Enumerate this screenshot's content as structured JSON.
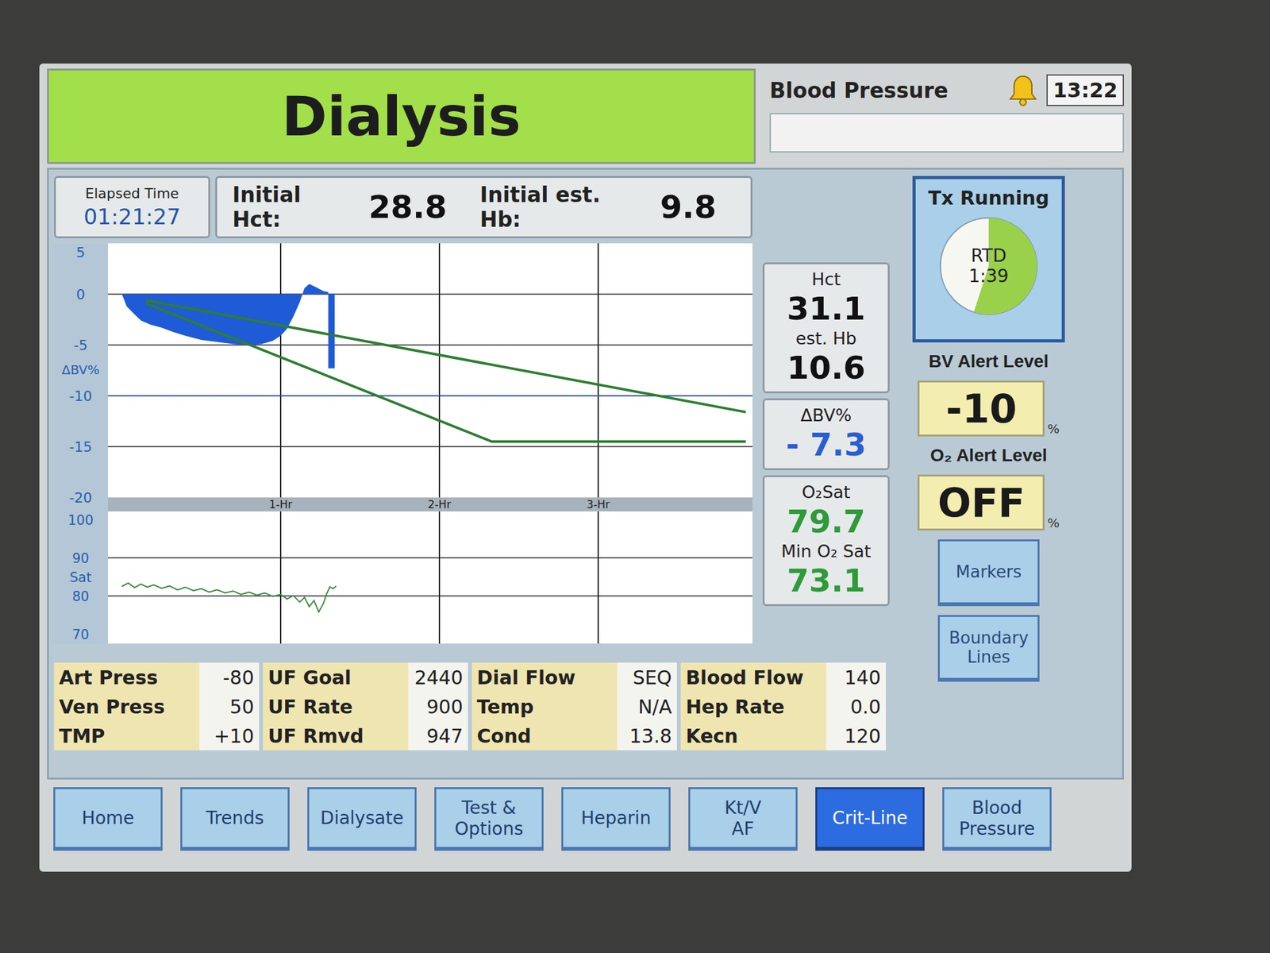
{
  "header": {
    "title": "Dialysis",
    "bp_label": "Blood Pressure",
    "time": "13:22"
  },
  "elapsed": {
    "label": "Elapsed Time",
    "value": "01:21:27"
  },
  "initial": {
    "hct_label": "Initial Hct:",
    "hct": "28.8",
    "hb_label": "Initial est. Hb:",
    "hb": "9.8"
  },
  "chart": {
    "bv_title": "ΔBV%",
    "bv_ticks": [
      {
        "label": "5",
        "value": 5
      },
      {
        "label": "0",
        "value": 0
      },
      {
        "label": "-5",
        "value": -5
      },
      {
        "label": "-10",
        "value": -10
      },
      {
        "label": "-15",
        "value": -15
      },
      {
        "label": "-20",
        "value": -20
      }
    ],
    "hour_ticks": [
      {
        "label": "1-Hr",
        "value": 1
      },
      {
        "label": "2-Hr",
        "value": 2
      },
      {
        "label": "3-Hr",
        "value": 3
      }
    ],
    "sat_title": "Sat",
    "sat_ticks": [
      {
        "label": "100",
        "value": 100
      },
      {
        "label": "90",
        "value": 90
      },
      {
        "label": "80",
        "value": 80
      },
      {
        "label": "70",
        "value": 70
      }
    ],
    "bv_series": [
      [
        0,
        0
      ],
      [
        0.03,
        -1.2
      ],
      [
        0.08,
        -2
      ],
      [
        0.12,
        -2.6
      ],
      [
        0.18,
        -3
      ],
      [
        0.25,
        -3.3
      ],
      [
        0.32,
        -3.7
      ],
      [
        0.4,
        -4.1
      ],
      [
        0.5,
        -4.5
      ],
      [
        0.6,
        -4.7
      ],
      [
        0.7,
        -4.9
      ],
      [
        0.8,
        -5
      ],
      [
        0.88,
        -4.9
      ],
      [
        0.95,
        -4.6
      ],
      [
        1.0,
        -4.1
      ],
      [
        1.04,
        -3.4
      ],
      [
        1.08,
        -2.2
      ],
      [
        1.12,
        -0.8
      ],
      [
        1.15,
        0.6
      ],
      [
        1.18,
        1.0
      ],
      [
        1.22,
        0.7
      ],
      [
        1.27,
        0.3
      ],
      [
        1.3,
        0.2
      ],
      [
        1.3,
        -7.3
      ],
      [
        1.34,
        -7.3
      ],
      [
        1.34,
        0
      ]
    ],
    "boundary_lines": [
      [
        [
          0.15,
          -0.6
        ],
        [
          3.93,
          -11.6
        ]
      ],
      [
        [
          0.15,
          -0.9
        ],
        [
          2.33,
          -14.5
        ],
        [
          3.93,
          -14.5
        ]
      ]
    ],
    "sat_series": [
      [
        0,
        82.5
      ],
      [
        0.04,
        83.4
      ],
      [
        0.08,
        82.2
      ],
      [
        0.12,
        83.1
      ],
      [
        0.16,
        82.3
      ],
      [
        0.2,
        82.9
      ],
      [
        0.25,
        82
      ],
      [
        0.3,
        82.6
      ],
      [
        0.35,
        81.6
      ],
      [
        0.4,
        82.3
      ],
      [
        0.45,
        81.4
      ],
      [
        0.5,
        81.9
      ],
      [
        0.55,
        81
      ],
      [
        0.6,
        81.6
      ],
      [
        0.65,
        80.8
      ],
      [
        0.7,
        81.3
      ],
      [
        0.75,
        80.4
      ],
      [
        0.8,
        81
      ],
      [
        0.85,
        80.2
      ],
      [
        0.9,
        80.8
      ],
      [
        0.95,
        79.9
      ],
      [
        1.0,
        80.4
      ],
      [
        1.04,
        79.2
      ],
      [
        1.08,
        80.1
      ],
      [
        1.12,
        78.4
      ],
      [
        1.15,
        79.6
      ],
      [
        1.18,
        77.2
      ],
      [
        1.21,
        78.8
      ],
      [
        1.24,
        75.8
      ],
      [
        1.27,
        78.1
      ],
      [
        1.29,
        80.6
      ],
      [
        1.31,
        82.4
      ],
      [
        1.33,
        81.9
      ],
      [
        1.35,
        82.6
      ]
    ]
  },
  "readouts": {
    "hct_label": "Hct",
    "hct": "31.1",
    "hb_label": "est. Hb",
    "hb": "10.6",
    "bv_label": "ΔBV%",
    "bv": "- 7.3",
    "o2_label": "O₂Sat",
    "o2": "79.7",
    "min_o2_label": "Min O₂ Sat",
    "min_o2": "73.1"
  },
  "treatment": {
    "status": "Tx Running",
    "rtd_label": "RTD",
    "rtd": "1:39",
    "level": 0.55
  },
  "bv_alert": {
    "label": "BV Alert Level",
    "value": "-10",
    "unit": "%"
  },
  "o2_alert": {
    "label": "O₂ Alert Level",
    "value": "OFF",
    "unit": "%"
  },
  "side_buttons": [
    {
      "lines": [
        "Markers"
      ]
    },
    {
      "lines": [
        "Boundary",
        "Lines"
      ]
    }
  ],
  "params": [
    [
      {
        "label": "Art Press",
        "value": "-80"
      },
      {
        "label": "Ven Press",
        "value": "50"
      },
      {
        "label": "TMP",
        "value": "+10"
      }
    ],
    [
      {
        "label": "UF Goal",
        "value": "2440"
      },
      {
        "label": "UF Rate",
        "value": "900"
      },
      {
        "label": "UF Rmvd",
        "value": "947"
      }
    ],
    [
      {
        "label": "Dial Flow",
        "value": "SEQ"
      },
      {
        "label": "Temp",
        "value": "N/A"
      },
      {
        "label": "Cond",
        "value": "13.8"
      }
    ],
    [
      {
        "label": "Blood Flow",
        "value": "140"
      },
      {
        "label": "Hep Rate",
        "value": "0.0"
      },
      {
        "label": "Kecn",
        "value": "120"
      }
    ]
  ],
  "tabs": [
    {
      "lines": [
        "Home"
      ],
      "selected": false
    },
    {
      "lines": [
        "Trends"
      ],
      "selected": false
    },
    {
      "lines": [
        "Dialysate"
      ],
      "selected": false
    },
    {
      "lines": [
        "Test &",
        "Options"
      ],
      "selected": false
    },
    {
      "lines": [
        "Heparin"
      ],
      "selected": false
    },
    {
      "lines": [
        "Kt/V",
        "AF"
      ],
      "selected": false
    },
    {
      "lines": [
        "Crit-Line"
      ],
      "selected": true
    },
    {
      "lines": [
        "Blood",
        "Pressure"
      ],
      "selected": false
    }
  ]
}
